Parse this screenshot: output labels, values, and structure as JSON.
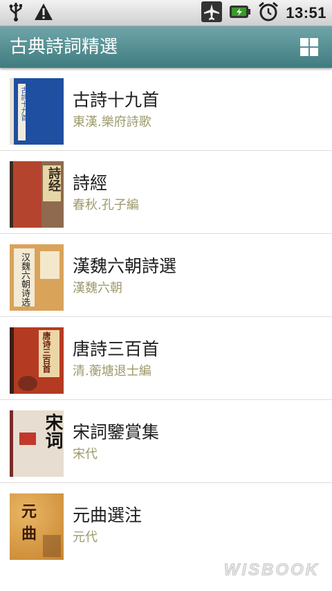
{
  "status_bar": {
    "time": "13:51",
    "icons": [
      "usb-icon",
      "warning-icon",
      "airplane-mode-icon",
      "battery-charging-icon",
      "alarm-icon"
    ]
  },
  "app_bar": {
    "title": "古典詩詞精選",
    "view_toggle_icon": "grid-view-icon"
  },
  "books": [
    {
      "title": "古詩十九首",
      "subtitle": "東漢.樂府詩歌",
      "cover_text": "古詩十九首",
      "cover_color": "#1f4fa0"
    },
    {
      "title": "詩經",
      "subtitle": "春秋.孔子編",
      "cover_text": "詩经",
      "cover_color": "#b5442f"
    },
    {
      "title": "漢魏六朝詩選",
      "subtitle": "漢魏六朝",
      "cover_text": "汉魏六朝诗选",
      "cover_color": "#d9a35a"
    },
    {
      "title": "唐詩三百首",
      "subtitle": "清.蘅塘退士編",
      "cover_text": "唐诗三百首",
      "cover_color": "#b53a22"
    },
    {
      "title": "宋詞鑒賞集",
      "subtitle": "宋代",
      "cover_text": "宋词",
      "cover_color": "#e7ddd0"
    },
    {
      "title": "元曲選注",
      "subtitle": "元代",
      "cover_text": "元曲",
      "cover_color": "#d39a47"
    }
  ],
  "watermark": "WISBOOK",
  "colors": {
    "app_bar": "#4f8a8d",
    "subtitle": "#9d9a6a",
    "divider": "#dcdcdc"
  }
}
